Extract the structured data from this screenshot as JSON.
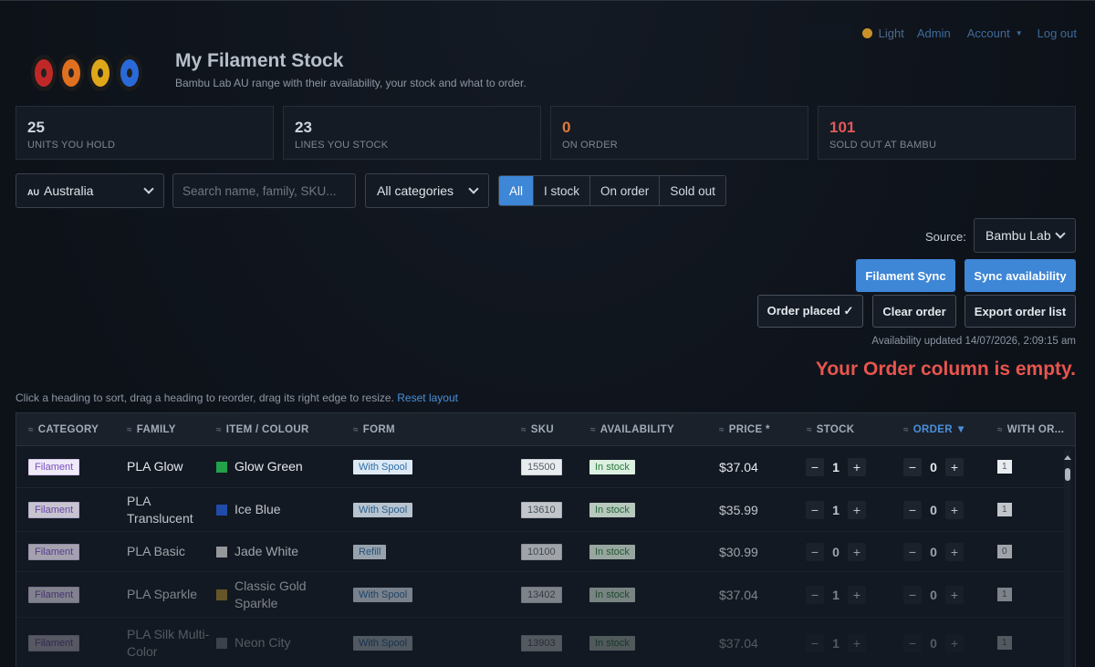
{
  "nav": {
    "theme_label": "Light",
    "admin": "Admin",
    "account": "Account",
    "logout": "Log out"
  },
  "header": {
    "title": "My Filament Stock",
    "subtitle": "Bambu Lab AU range with their availability, your stock and what to order."
  },
  "stats": [
    {
      "value": "25",
      "label": "UNITS YOU HOLD"
    },
    {
      "value": "23",
      "label": "LINES YOU STOCK"
    },
    {
      "value": "0",
      "label": "ON ORDER"
    },
    {
      "value": "101",
      "label": "SOLD OUT AT BAMBU"
    }
  ],
  "filters": {
    "region_flag": "AU",
    "region": "Australia",
    "search_placeholder": "Search name, family, SKU...",
    "category": "All categories",
    "segments": [
      "All",
      "I stock",
      "On order",
      "Sold out"
    ],
    "active_segment": "All"
  },
  "source": {
    "label": "Source:",
    "value": "Bambu Lab"
  },
  "actions": {
    "filament_sync": "Filament Sync",
    "sync_availability": "Sync availability",
    "order_placed": "Order placed ✓",
    "clear_order": "Clear order",
    "export_order": "Export order list"
  },
  "status": {
    "availability_updated": "Availability updated 14/07/2026, 2:09:15 am",
    "order_empty": "Your Order column is empty."
  },
  "hint": {
    "text": "Click a heading to sort, drag a heading to reorder, drag its right edge to resize.",
    "reset": "Reset layout"
  },
  "table": {
    "headers": [
      "CATEGORY",
      "FAMILY",
      "ITEM / COLOUR",
      "FORM",
      "SKU",
      "AVAILABILITY",
      "PRICE *",
      "STOCK",
      "ORDER ▼",
      "WITH OR..."
    ],
    "rows": [
      {
        "category": "Filament",
        "family": "PLA Glow",
        "item": "Glow Green",
        "swatch": "#22a04a",
        "form": "With Spool",
        "sku": "15500",
        "availability": "In stock",
        "price": "$37.04",
        "stock": "1",
        "order": "0",
        "with_order": "1"
      },
      {
        "category": "Filament",
        "family": "PLA Translucent",
        "item": "Ice Blue",
        "swatch": "#2456c8",
        "form": "With Spool",
        "sku": "13610",
        "availability": "In stock",
        "price": "$35.99",
        "stock": "1",
        "order": "0",
        "with_order": "1"
      },
      {
        "category": "Filament",
        "family": "PLA Basic",
        "item": "Jade White",
        "swatch": "#d8d8d8",
        "form": "Refill",
        "sku": "10100",
        "availability": "In stock",
        "price": "$30.99",
        "stock": "0",
        "order": "0",
        "with_order": "0"
      },
      {
        "category": "Filament",
        "family": "PLA Sparkle",
        "item": "Classic Gold Sparkle",
        "swatch": "#b8922e",
        "form": "With Spool",
        "sku": "13402",
        "availability": "In stock",
        "price": "$37.04",
        "stock": "1",
        "order": "0",
        "with_order": "1"
      },
      {
        "category": "Filament",
        "family": "PLA Silk Multi-Color",
        "item": "Neon City",
        "swatch": "#9aa0a8",
        "form": "With Spool",
        "sku": "13903",
        "availability": "In stock",
        "price": "$37.04",
        "stock": "1",
        "order": "0",
        "with_order": "1"
      }
    ]
  }
}
